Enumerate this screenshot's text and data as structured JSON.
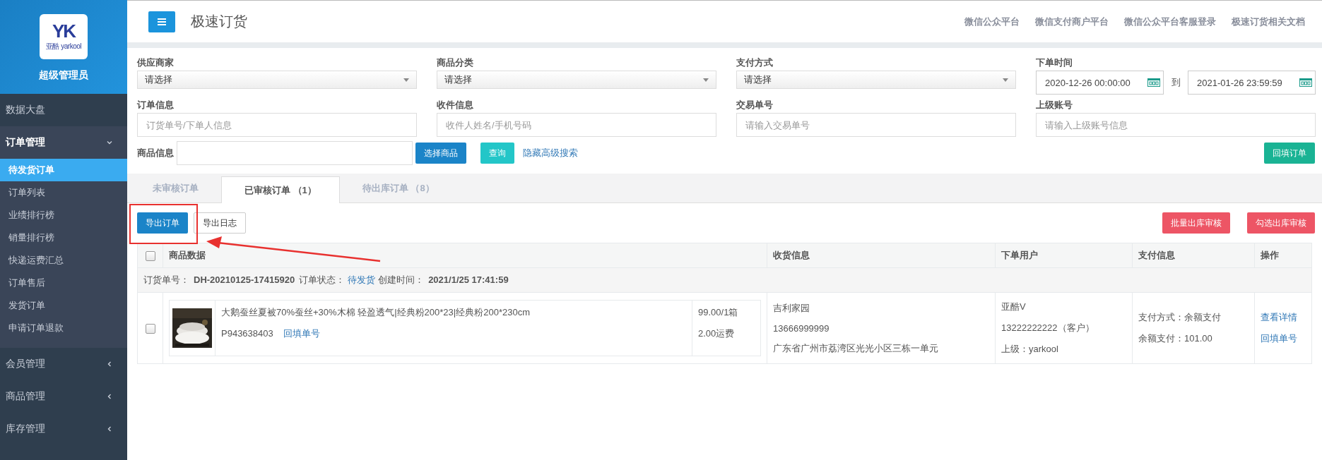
{
  "sidebar": {
    "logo": {
      "mark": "YK",
      "text": "亚酷 yarkool"
    },
    "user": "超级管理员",
    "items": [
      {
        "label": "数据大盘",
        "expanded": false,
        "kind": "plain"
      },
      {
        "label": "订单管理",
        "expanded": true,
        "kind": "group",
        "children": [
          {
            "label": "待发货订单",
            "selected": true
          },
          {
            "label": "订单列表",
            "selected": false
          },
          {
            "label": "业绩排行榜",
            "selected": false
          },
          {
            "label": "销量排行榜",
            "selected": false
          },
          {
            "label": "快递运费汇总",
            "selected": false
          },
          {
            "label": "订单售后",
            "selected": false
          },
          {
            "label": "发货订单",
            "selected": false
          },
          {
            "label": "申请订单退款",
            "selected": false
          }
        ]
      },
      {
        "label": "会员管理",
        "expanded": false,
        "kind": "group"
      },
      {
        "label": "商品管理",
        "expanded": false,
        "kind": "group"
      },
      {
        "label": "库存管理",
        "expanded": false,
        "kind": "group"
      }
    ]
  },
  "header": {
    "title": "极速订货",
    "links": [
      "微信公众平台",
      "微信支付商户平台",
      "微信公众平台客服登录",
      "极速订货相关文档"
    ]
  },
  "filters": [
    {
      "label": "供应商家",
      "kind": "select",
      "value": "请选择"
    },
    {
      "label": "商品分类",
      "kind": "select",
      "value": "请选择"
    },
    {
      "label": "支付方式",
      "kind": "select",
      "value": "请选择"
    },
    {
      "label": "下单时间",
      "kind": "daterange",
      "from": "2020-12-26 00:00:00",
      "sep": "到",
      "to": "2021-01-26 23:59:59"
    },
    {
      "label": "订单信息",
      "kind": "input",
      "placeholder": "订货单号/下单人信息"
    },
    {
      "label": "收件信息",
      "kind": "input",
      "placeholder": "收件人姓名/手机号码"
    },
    {
      "label": "交易单号",
      "kind": "input",
      "placeholder": "请输入交易单号"
    },
    {
      "label": "上级账号",
      "kind": "input",
      "placeholder": "请输入上级账号信息"
    }
  ],
  "product_search": {
    "label": "商品信息",
    "choose": "选择商品",
    "query": "查询",
    "toggle": "隐藏高级搜索",
    "backfill": "回填订单"
  },
  "tabs": [
    {
      "label": "未审核订单",
      "selected": false
    },
    {
      "label": "已审核订单 （1）",
      "selected": true
    },
    {
      "label": "待出库订单 （8）",
      "selected": false
    }
  ],
  "toolbar": {
    "export": "导出订单",
    "log": "导出日志",
    "batch": "批量出库审核",
    "checked": "勾选出库审核"
  },
  "table": {
    "all_checked": false,
    "columns": [
      "商品数据",
      "收货信息",
      "下单用户",
      "支付信息",
      "操作"
    ],
    "orders": [
      {
        "checked": false,
        "number_label": "订货单号：",
        "number": "DH-20210125-17415920",
        "status_label": "订单状态：",
        "status": "待发货",
        "created_label": "创建时间：",
        "created": "2021/1/25 17:41:59",
        "item": {
          "name": "大鹅蚕丝夏被70%蚕丝+30%木棉 轻盈透气|经典粉200*23|经典粉200*230cm",
          "sku": "P943638403",
          "sku_link": "回填单号",
          "price": "99.00/1箱",
          "freight": "2.00运费"
        },
        "receiver": [
          "吉利家园",
          "13666999999",
          "广东省广州市荔湾区光光小区三栋一单元"
        ],
        "user": [
          "亚酷V",
          "13222222222（客户）",
          "上级：yarkool"
        ],
        "payment": [
          "支付方式：余额支付",
          "余额支付：101.00"
        ],
        "actions": [
          "查看详情",
          "回填单号"
        ]
      }
    ]
  }
}
